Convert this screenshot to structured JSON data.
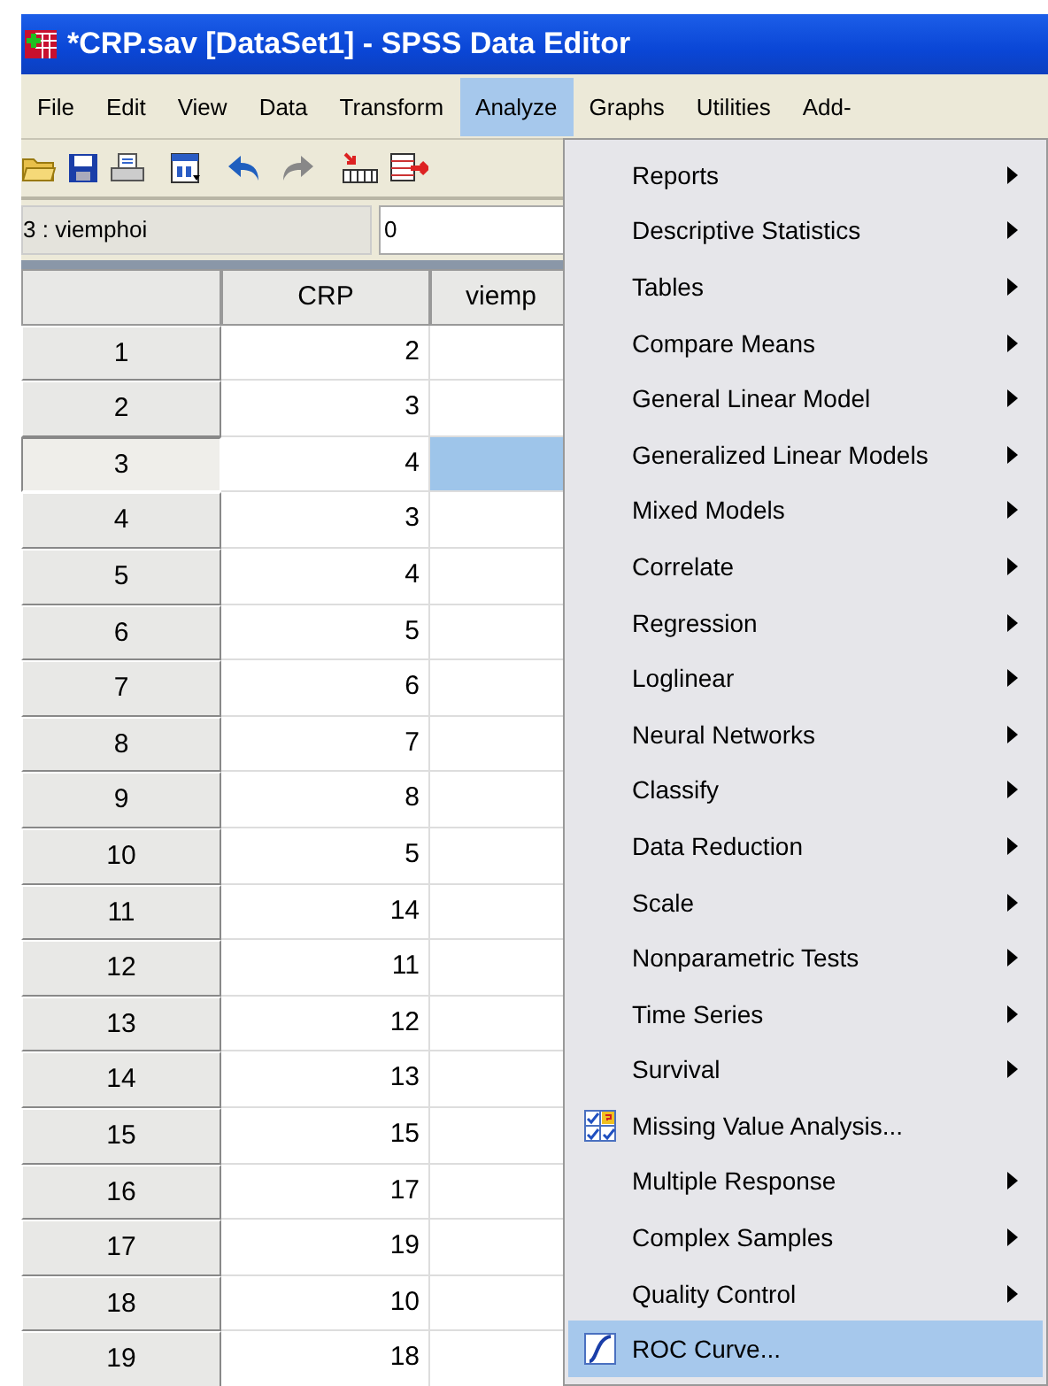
{
  "window": {
    "title": "*CRP.sav [DataSet1] - SPSS Data Editor"
  },
  "menu_bar": [
    {
      "label": "File",
      "selected": false
    },
    {
      "label": "Edit",
      "selected": false
    },
    {
      "label": "View",
      "selected": false
    },
    {
      "label": "Data",
      "selected": false
    },
    {
      "label": "Transform",
      "selected": false
    },
    {
      "label": "Analyze",
      "selected": true
    },
    {
      "label": "Graphs",
      "selected": false
    },
    {
      "label": "Utilities",
      "selected": false
    },
    {
      "label": "Add-",
      "selected": false
    }
  ],
  "cell_editor": {
    "cell_name": "3 : viemphoi",
    "value": "0"
  },
  "table": {
    "columns": [
      "CRP",
      "viemp"
    ],
    "rows": [
      {
        "row_number": "1",
        "crp": "2",
        "selected": false
      },
      {
        "row_number": "2",
        "crp": "3",
        "selected": false
      },
      {
        "row_number": "3",
        "crp": "4",
        "selected": true
      },
      {
        "row_number": "4",
        "crp": "3",
        "selected": false
      },
      {
        "row_number": "5",
        "crp": "4",
        "selected": false
      },
      {
        "row_number": "6",
        "crp": "5",
        "selected": false
      },
      {
        "row_number": "7",
        "crp": "6",
        "selected": false
      },
      {
        "row_number": "8",
        "crp": "7",
        "selected": false
      },
      {
        "row_number": "9",
        "crp": "8",
        "selected": false
      },
      {
        "row_number": "10",
        "crp": "5",
        "selected": false
      },
      {
        "row_number": "11",
        "crp": "14",
        "selected": false
      },
      {
        "row_number": "12",
        "crp": "11",
        "selected": false
      },
      {
        "row_number": "13",
        "crp": "12",
        "selected": false
      },
      {
        "row_number": "14",
        "crp": "13",
        "selected": false
      },
      {
        "row_number": "15",
        "crp": "15",
        "selected": false
      },
      {
        "row_number": "16",
        "crp": "17",
        "selected": false
      },
      {
        "row_number": "17",
        "crp": "19",
        "selected": false
      },
      {
        "row_number": "18",
        "crp": "10",
        "selected": false
      },
      {
        "row_number": "19",
        "crp": "18",
        "selected": false
      }
    ]
  },
  "analyze_menu": [
    {
      "label": "Reports",
      "kind": "submenu",
      "selected": false
    },
    {
      "label": "Descriptive Statistics",
      "kind": "submenu",
      "selected": false
    },
    {
      "label": "Tables",
      "kind": "submenu",
      "selected": false
    },
    {
      "label": "Compare Means",
      "kind": "submenu",
      "selected": false
    },
    {
      "label": "General Linear Model",
      "kind": "submenu",
      "selected": false
    },
    {
      "label": "Generalized Linear Models",
      "kind": "submenu",
      "selected": false
    },
    {
      "label": "Mixed Models",
      "kind": "submenu",
      "selected": false
    },
    {
      "label": "Correlate",
      "kind": "submenu",
      "selected": false
    },
    {
      "label": "Regression",
      "kind": "submenu",
      "selected": false
    },
    {
      "label": "Loglinear",
      "kind": "submenu",
      "selected": false
    },
    {
      "label": "Neural Networks",
      "kind": "submenu",
      "selected": false
    },
    {
      "label": "Classify",
      "kind": "submenu",
      "selected": false
    },
    {
      "label": "Data Reduction",
      "kind": "submenu",
      "selected": false
    },
    {
      "label": "Scale",
      "kind": "submenu",
      "selected": false
    },
    {
      "label": "Nonparametric Tests",
      "kind": "submenu",
      "selected": false
    },
    {
      "label": "Time Series",
      "kind": "submenu",
      "selected": false
    },
    {
      "label": "Survival",
      "kind": "submenu",
      "selected": false
    },
    {
      "label": "Missing Value Analysis...",
      "kind": "checklist-dialog",
      "selected": false
    },
    {
      "label": "Multiple Response",
      "kind": "submenu",
      "selected": false
    },
    {
      "label": "Complex Samples",
      "kind": "submenu",
      "selected": false
    },
    {
      "label": "Quality Control",
      "kind": "submenu",
      "selected": false
    },
    {
      "label": "ROC Curve...",
      "kind": "curve-dialog",
      "selected": true
    }
  ]
}
